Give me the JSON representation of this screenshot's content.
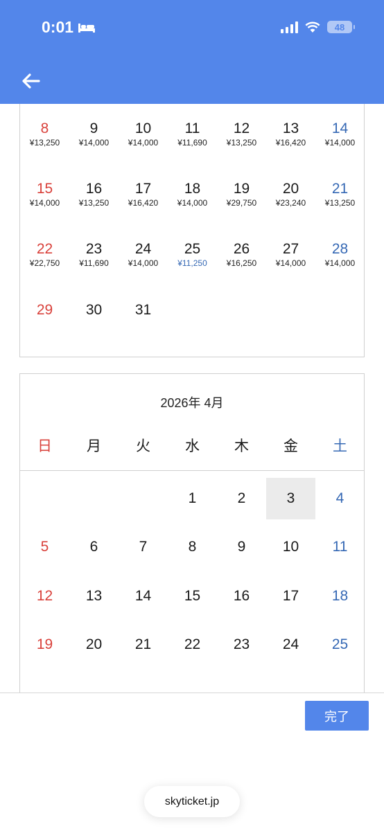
{
  "status_bar": {
    "time": "0:01",
    "battery": "48"
  },
  "march": {
    "rows": [
      [
        {
          "day": "8",
          "price": "¥13,250",
          "kind": "sun"
        },
        {
          "day": "9",
          "price": "¥14,000"
        },
        {
          "day": "10",
          "price": "¥14,000"
        },
        {
          "day": "11",
          "price": "¥11,690"
        },
        {
          "day": "12",
          "price": "¥13,250"
        },
        {
          "day": "13",
          "price": "¥16,420"
        },
        {
          "day": "14",
          "price": "¥14,000",
          "kind": "sat"
        }
      ],
      [
        {
          "day": "15",
          "price": "¥14,000",
          "kind": "sun"
        },
        {
          "day": "16",
          "price": "¥13,250"
        },
        {
          "day": "17",
          "price": "¥16,420"
        },
        {
          "day": "18",
          "price": "¥14,000"
        },
        {
          "day": "19",
          "price": "¥29,750"
        },
        {
          "day": "20",
          "price": "¥23,240"
        },
        {
          "day": "21",
          "price": "¥13,250",
          "kind": "sat"
        }
      ],
      [
        {
          "day": "22",
          "price": "¥22,750",
          "kind": "sun"
        },
        {
          "day": "23",
          "price": "¥11,690"
        },
        {
          "day": "24",
          "price": "¥14,000"
        },
        {
          "day": "25",
          "price": "¥11,250",
          "cheapest": true
        },
        {
          "day": "26",
          "price": "¥16,250"
        },
        {
          "day": "27",
          "price": "¥14,000"
        },
        {
          "day": "28",
          "price": "¥14,000",
          "kind": "sat"
        }
      ],
      [
        {
          "day": "29",
          "price": "",
          "kind": "sun"
        },
        {
          "day": "30",
          "price": ""
        },
        {
          "day": "31",
          "price": ""
        }
      ]
    ]
  },
  "april": {
    "title": "2026年 4月",
    "weekdays": [
      "日",
      "月",
      "火",
      "水",
      "木",
      "金",
      "土"
    ],
    "selected_day": "3",
    "rows": [
      [
        "",
        "",
        "",
        "1",
        "2",
        "3",
        "4"
      ],
      [
        "5",
        "6",
        "7",
        "8",
        "9",
        "10",
        "11"
      ],
      [
        "12",
        "13",
        "14",
        "15",
        "16",
        "17",
        "18"
      ],
      [
        "19",
        "20",
        "21",
        "22",
        "23",
        "24",
        "25"
      ]
    ]
  },
  "footer": {
    "done_label": "完了",
    "url": "skyticket.jp"
  },
  "colors": {
    "header": "#5386ea",
    "sunday": "#d9413b",
    "saturday": "#3568b4"
  }
}
